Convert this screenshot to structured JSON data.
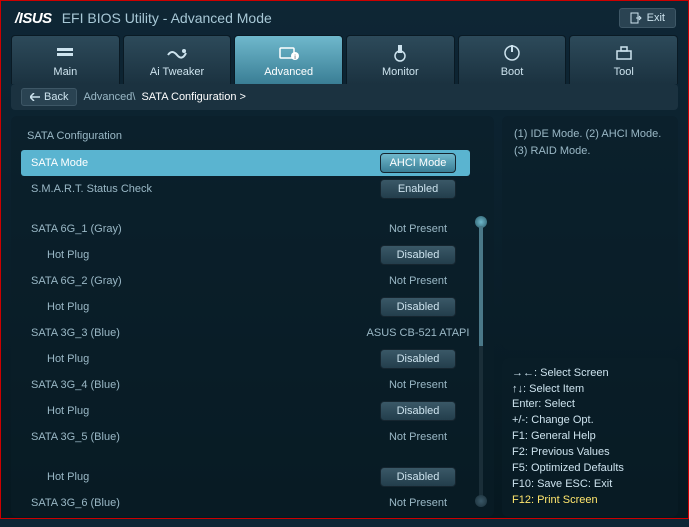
{
  "header": {
    "logo": "/ISUS",
    "title": "EFI BIOS Utility - Advanced Mode",
    "exit": "Exit"
  },
  "tabs": [
    {
      "label": "Main"
    },
    {
      "label": "Ai Tweaker"
    },
    {
      "label": "Advanced"
    },
    {
      "label": "Monitor"
    },
    {
      "label": "Boot"
    },
    {
      "label": "Tool"
    }
  ],
  "breadcrumb": {
    "back": "Back",
    "path": "Advanced\\",
    "current": "SATA Configuration  >"
  },
  "section_title": "SATA Configuration",
  "rows": [
    {
      "label": "SATA Mode",
      "value": "AHCI Mode",
      "btn": true,
      "selected": true,
      "active": true
    },
    {
      "label": "S.M.A.R.T. Status Check",
      "value": "Enabled",
      "btn": true
    },
    {
      "spacer": true
    },
    {
      "label": "SATA 6G_1 (Gray)",
      "value": "Not Present"
    },
    {
      "label": "Hot Plug",
      "value": "Disabled",
      "btn": true,
      "indent": true
    },
    {
      "label": "SATA 6G_2 (Gray)",
      "value": "Not Present"
    },
    {
      "label": "Hot Plug",
      "value": "Disabled",
      "btn": true,
      "indent": true
    },
    {
      "label": "SATA 3G_3 (Blue)",
      "value": "ASUS    CB-521 ATAPI"
    },
    {
      "label": "Hot Plug",
      "value": "Disabled",
      "btn": true,
      "indent": true
    },
    {
      "label": "SATA 3G_4 (Blue)",
      "value": "Not Present"
    },
    {
      "label": "Hot Plug",
      "value": "Disabled",
      "btn": true,
      "indent": true
    },
    {
      "label": "SATA 3G_5 (Blue)",
      "value": "Not Present"
    },
    {
      "spacer": true
    },
    {
      "label": "Hot Plug",
      "value": "Disabled",
      "btn": true,
      "indent": true
    },
    {
      "label": "SATA 3G_6 (Blue)",
      "value": "Not Present"
    }
  ],
  "help_text": "(1) IDE Mode. (2) AHCI Mode. (3) RAID Mode.",
  "keys": [
    {
      "k": "→←:",
      "v": "Select Screen"
    },
    {
      "k": "↑↓:",
      "v": "Select Item"
    },
    {
      "k": "Enter:",
      "v": "Select"
    },
    {
      "k": "+/-:",
      "v": "Change Opt."
    },
    {
      "k": "F1:",
      "v": "General Help"
    },
    {
      "k": "F2:",
      "v": "Previous Values"
    },
    {
      "k": "F5:",
      "v": "Optimized Defaults"
    },
    {
      "k": "F10:",
      "v": "Save   ESC:  Exit"
    },
    {
      "k": "F12:",
      "v": "Print Screen",
      "hl": true
    }
  ]
}
